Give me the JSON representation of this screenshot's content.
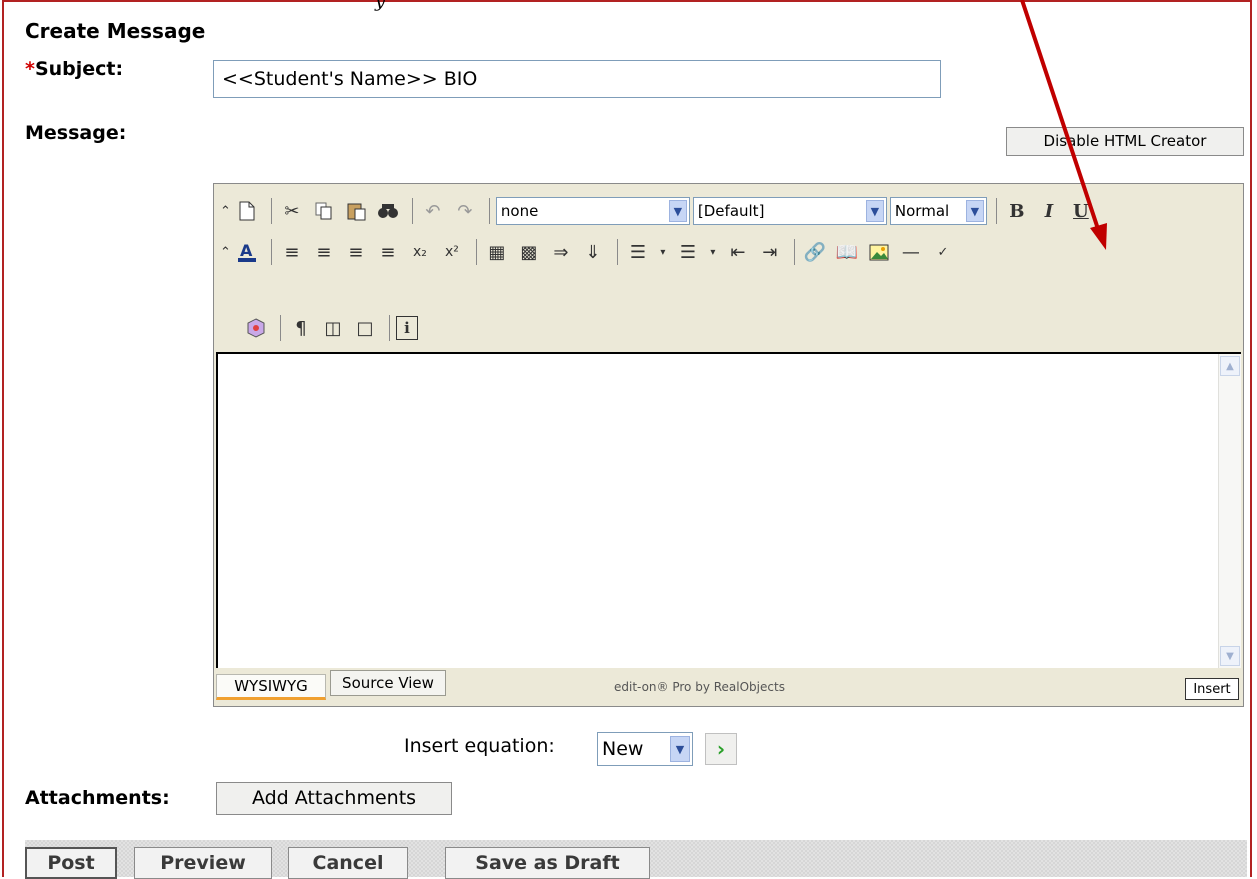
{
  "header_fragment": "y",
  "page_title": "Create Message",
  "subject": {
    "required_mark": "*",
    "label": "Subject:",
    "value": "<<Student's Name>> BIO"
  },
  "message_label": "Message:",
  "disable_html_button": "Disable HTML Creator",
  "toolbar": {
    "style_select": "none",
    "font_select": "[Default]",
    "size_select": "Normal",
    "bold": "B",
    "italic": "I",
    "underline": "U"
  },
  "editor_tabs": {
    "wysiwyg": "WYSIWYG",
    "source": "Source View"
  },
  "editor_brand": "edit-on® Pro by RealObjects",
  "insert_mode": "Insert",
  "equation": {
    "label": "Insert equation:",
    "value": "New"
  },
  "attachments": {
    "label": "Attachments:",
    "button": "Add Attachments"
  },
  "actions": {
    "post": "Post",
    "preview": "Preview",
    "cancel": "Cancel",
    "save_draft": "Save as Draft"
  },
  "colors": {
    "frame": "#b22222",
    "arrow": "#c00000",
    "toolbar_bg": "#ece9d8",
    "active_tab_underline": "#f0a030"
  }
}
